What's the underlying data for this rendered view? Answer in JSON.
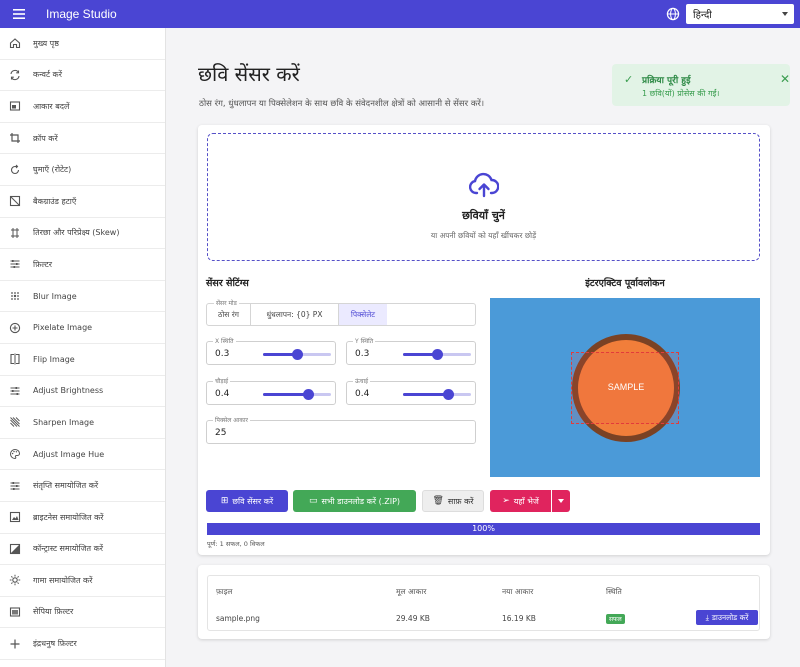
{
  "header": {
    "title": "Image Studio",
    "language": "हिन्दी",
    "menu_icon": "menu-icon",
    "globe_icon": "globe-icon"
  },
  "sidebar": {
    "items": [
      {
        "label": "मुख्य पृष्ठ",
        "icon": "home-icon"
      },
      {
        "label": "कन्वर्ट करें",
        "icon": "convert-icon"
      },
      {
        "label": "आकार बदलें",
        "icon": "resize-icon"
      },
      {
        "label": "क्रॉप करें",
        "icon": "crop-icon"
      },
      {
        "label": "घुमाएँ (रोटेट)",
        "icon": "rotate-icon"
      },
      {
        "label": "बैकग्राउंड हटाएँ",
        "icon": "remove-background-icon"
      },
      {
        "label": "तिरछा और परिप्रेक्ष्य (Skew)",
        "icon": "skew-icon"
      },
      {
        "label": "फ़िल्टर",
        "icon": "filter-icon"
      },
      {
        "label": "Blur Image",
        "icon": "blur-icon"
      },
      {
        "label": "Pixelate Image",
        "icon": "pixelate-icon"
      },
      {
        "label": "Flip Image",
        "icon": "flip-icon"
      },
      {
        "label": "Adjust Brightness",
        "icon": "brightness-icon"
      },
      {
        "label": "Sharpen Image",
        "icon": "sharpen-icon"
      },
      {
        "label": "Adjust Image Hue",
        "icon": "palette-icon"
      },
      {
        "label": "संतृप्ति समायोजित करें",
        "icon": "saturation-icon"
      },
      {
        "label": "ब्राइटनेस समायोजित करें",
        "icon": "brightness-adjust-icon"
      },
      {
        "label": "कॉन्ट्रास्ट समायोजित करें",
        "icon": "contrast-icon"
      },
      {
        "label": "गामा समायोजित करें",
        "icon": "gamma-icon"
      },
      {
        "label": "सेपिया फ़िल्टर",
        "icon": "sepia-icon"
      },
      {
        "label": "इंद्रधनुष फ़िल्टर",
        "icon": "rainbow-icon"
      }
    ]
  },
  "page": {
    "title": "छवि सेंसर करें",
    "description": "ठोस रंग, धुंधलापन या पिक्सेलेशन के साथ छवि के संवेदनशील क्षेत्रों को आसानी से सेंसर करें।"
  },
  "toast": {
    "title": "प्रक्रिया पूरी हुई",
    "message": "1 छवि(यों) प्रोसेस की गईं।",
    "close": "✕",
    "check": "✓"
  },
  "upload": {
    "title": "छवियाँ चुनें",
    "hint": "या अपनी छवियों को यहाँ खींचकर छोड़ें"
  },
  "settings": {
    "title": "सेंसर सेटिंग्स",
    "mode_legend": "सेंसर मोड",
    "modes": [
      "ठोस रंग",
      "धुंधलापन: {0} PX",
      "पिक्सेलेट"
    ],
    "selected_mode": "पिक्सेलेट",
    "fields": {
      "x": {
        "legend": "X स्थिति",
        "value": "0.3",
        "fraction": 0.3
      },
      "y": {
        "legend": "Y स्थिति",
        "value": "0.3",
        "fraction": 0.3
      },
      "width": {
        "legend": "चौड़ाई",
        "value": "0.4",
        "fraction": 0.4
      },
      "height": {
        "legend": "ऊंचाई",
        "value": "0.4",
        "fraction": 0.4
      },
      "pixel": {
        "legend": "पिक्सेल आकार",
        "value": "25"
      }
    }
  },
  "preview": {
    "title": "इंटरएक्टिव पूर्वावलोकन",
    "sample_text": "SAMPLE",
    "bg_color": "#4b9ad8",
    "circle_color": "#f17e3a",
    "ring_color": "#7a4224"
  },
  "actions": {
    "censor": "छवि सेंसर करें",
    "download_all": "सभी डाउनलोड करें (.ZIP)",
    "clear": "साफ़ करें",
    "share": "यहाँ भेजें"
  },
  "progress": {
    "label": "100%",
    "value": 1.0,
    "status": "पूर्ण: 1 सफल, 0 विफल"
  },
  "results": {
    "headers": [
      "फ़ाइल",
      "मूल आकार",
      "नया आकार",
      "स्थिति",
      ""
    ],
    "rows": [
      {
        "file": "sample.png",
        "original": "29.49 KB",
        "new": "16.19 KB",
        "status": "सफल",
        "action": "डाउनलोड करें"
      }
    ]
  },
  "colors": {
    "primary": "#4a45d3",
    "success": "#43a857",
    "share": "#e0245e"
  }
}
